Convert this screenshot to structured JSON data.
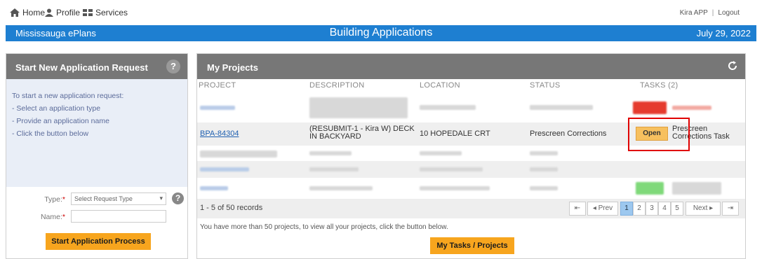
{
  "topnav": {
    "home": "Home",
    "profile": "Profile",
    "services": "Services",
    "user": "Kira APP",
    "logout": "Logout"
  },
  "header": {
    "site": "Mississauga ePlans",
    "title": "Building Applications",
    "date": "July 29, 2022"
  },
  "left": {
    "title": "Start New Application Request",
    "help": "?",
    "instructions": [
      "To start a new application request:",
      "- Select an application type",
      "- Provide an application name",
      "- Click the button below"
    ],
    "type_label": "Type:",
    "type_value": "Select Request Type",
    "name_label": "Name:",
    "name_value": "",
    "required_mark": "*",
    "start_button": "Start Application Process"
  },
  "projects": {
    "title": "My Projects",
    "columns": [
      "PROJECT",
      "DESCRIPTION",
      "LOCATION",
      "STATUS",
      "TASKS (2)"
    ],
    "visible_row": {
      "project": "BPA-84304",
      "description": "(RESUBMIT-1 - Kira W) DECK IN BACKYARD",
      "location": "10 HOPEDALE CRT",
      "status": "Prescreen Corrections",
      "task_button": "Open",
      "task_name": "Prescreen Corrections Task"
    },
    "records": "1 - 5 of 50 records",
    "pager": {
      "first": "⇤",
      "prev": "◂ Prev",
      "pages": [
        "1",
        "2",
        "3",
        "4",
        "5"
      ],
      "next": "Next ▸",
      "last": "⇥"
    },
    "note": "You have more than 50 projects, to view all your projects, click the button below.",
    "tasks_button": "My Tasks / Projects"
  }
}
